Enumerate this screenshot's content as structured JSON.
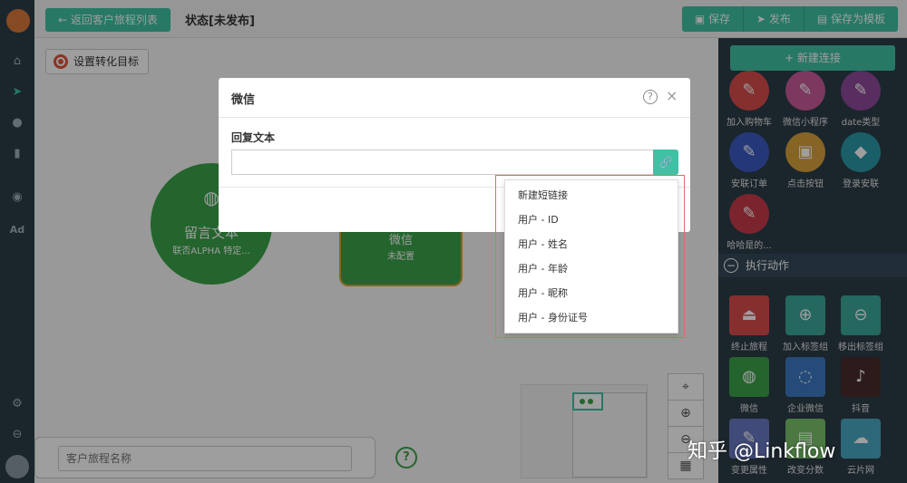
{
  "topbar": {
    "back_label": "← 返回客户旅程列表",
    "status": "状态[未发布]",
    "buttons": [
      "▣ 保存",
      "➤ 发布",
      "▤ 保存为模板"
    ]
  },
  "canvas": {
    "goal_label": "设置转化目标",
    "node_message": {
      "title": "留言文本",
      "subtitle": "联否ALPHA 特定..."
    },
    "node_wechat": {
      "title": "微信",
      "subtitle": "未配置"
    },
    "name_placeholder": "客户旅程名称",
    "help_glyph": "?"
  },
  "right_panel": {
    "new_connection": "+ 新建连接",
    "items_top": [
      {
        "label": "加入购物车",
        "color": "#d84c4c",
        "icon": "wrench-icon"
      },
      {
        "label": "微信小程序",
        "color": "#c95b9a",
        "icon": "wrench-icon"
      },
      {
        "label": "date类型",
        "color": "#8e4a9a",
        "icon": "wrench-icon"
      },
      {
        "label": "安联订单",
        "color": "#3a5bc4",
        "icon": "wrench-icon"
      },
      {
        "label": "点击按钮",
        "color": "#d8a23a",
        "icon": "truck-icon"
      },
      {
        "label": "登录安联",
        "color": "#2a9aa8",
        "icon": "bird-icon"
      },
      {
        "label": "哈哈是的...",
        "color": "#c93a4a",
        "icon": "wrench-icon"
      }
    ],
    "section_label": "执行动作",
    "items_actions": [
      {
        "label": "终止旅程",
        "color": "#d84c4c",
        "icon": "eject-icon"
      },
      {
        "label": "加入标签组",
        "color": "#3aa89a",
        "icon": "user-add-icon"
      },
      {
        "label": "移出标签组",
        "color": "#3aa89a",
        "icon": "user-remove-icon"
      },
      {
        "label": "微信",
        "color": "#3aa24a",
        "icon": "wechat-icon"
      },
      {
        "label": "企业微信",
        "color": "#3a7ac4",
        "icon": "chat-icon"
      },
      {
        "label": "抖音",
        "color": "#4a2a2a",
        "icon": "tiktok-icon"
      },
      {
        "label": "变更属性",
        "color": "#6a7ac4",
        "icon": "edit-icon"
      },
      {
        "label": "改变分数",
        "color": "#7ac46a",
        "icon": "score-icon"
      },
      {
        "label": "云片网",
        "color": "#4aa8c4",
        "icon": "cloud-icon"
      }
    ]
  },
  "rail": {
    "icons": [
      "home-icon",
      "send-icon",
      "user-icon",
      "bar-chart-icon",
      "chat-icon",
      "ad-icon",
      "gear-icon",
      "minus-circle-icon"
    ],
    "ad_label": "Ad"
  },
  "modal": {
    "title": "微信",
    "help": "?",
    "close": "×",
    "field_label": "回复文本",
    "field_value": ""
  },
  "dropdown": {
    "items": [
      "新建短链接",
      "用户 - ID",
      "用户 - 姓名",
      "用户 - 年龄",
      "用户 - 昵称",
      "用户 - 身份证号"
    ]
  },
  "watermark": "知乎 @Linkflow",
  "colors": {
    "accent": "#3fc2a4",
    "node_green": "#3aa24a",
    "panel_dark": "#2d3c48"
  }
}
